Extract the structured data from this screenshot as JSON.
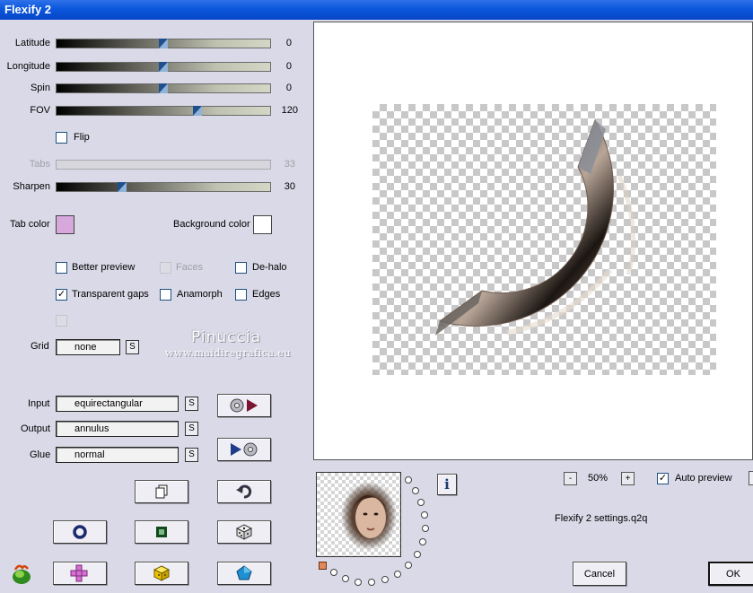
{
  "window": {
    "title": "Flexify 2"
  },
  "sliders": [
    {
      "id": "latitude",
      "label": "Latitude",
      "value": "0",
      "level": 0.5,
      "enabled": true
    },
    {
      "id": "longitude",
      "label": "Longitude",
      "value": "0",
      "level": 0.5,
      "enabled": true
    },
    {
      "id": "spin",
      "label": "Spin",
      "value": "0",
      "level": 0.5,
      "enabled": true
    },
    {
      "id": "fov",
      "label": "FOV",
      "value": "120",
      "level": 0.66,
      "enabled": true
    },
    {
      "id": "tabs",
      "label": "Tabs",
      "value": "33",
      "level": 0.33,
      "enabled": false
    },
    {
      "id": "sharpen",
      "label": "Sharpen",
      "value": "30",
      "level": 0.3,
      "enabled": true
    }
  ],
  "options": {
    "flip": {
      "label": "Flip",
      "checked": false
    },
    "better_preview": {
      "label": "Better preview",
      "checked": false
    },
    "faces": {
      "label": "Faces",
      "checked": false,
      "enabled": false
    },
    "de_halo": {
      "label": "De-halo",
      "checked": false
    },
    "transparent_gaps": {
      "label": "Transparent gaps",
      "checked": true,
      "mark": "✓"
    },
    "anamorph": {
      "label": "Anamorph",
      "checked": false
    },
    "edges": {
      "label": "Edges",
      "checked": false
    }
  },
  "colors": {
    "tab_color_label": "Tab color",
    "tab_color": "#d6a8dc",
    "background_color_label": "Background color",
    "background_color": "#ffffff"
  },
  "grid": {
    "label": "Grid",
    "value": "none",
    "s_label": "S"
  },
  "projection": {
    "input": {
      "label": "Input",
      "value": "equirectangular",
      "s_label": "S"
    },
    "output": {
      "label": "Output",
      "value": "annulus",
      "s_label": "S"
    },
    "glue": {
      "label": "Glue",
      "value": "normal",
      "s_label": "S"
    }
  },
  "watermark": {
    "name": "Pinuccia",
    "url": "www.maidiregrafica.eu"
  },
  "zoom": {
    "minus": "-",
    "value": "50%",
    "plus": "+"
  },
  "auto_preview": {
    "label": "Auto preview",
    "checked": true,
    "mark": "✓"
  },
  "settings_file": "Flexify 2 settings.q2q",
  "info_label": "i",
  "buttons": {
    "cancel": "Cancel",
    "ok": "OK"
  },
  "accent_colors": {
    "titlebar": "#0b57dd",
    "slider_thumb": "#1f4f8c",
    "window_bg": "#d9d9e7"
  }
}
